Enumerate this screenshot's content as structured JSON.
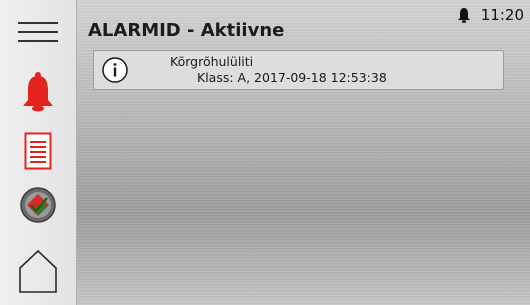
{
  "header": {
    "title": "ALARMID - Aktiivne"
  },
  "status_bar": {
    "time": "11:20",
    "notification_icon": "bell-icon"
  },
  "sidebar": {
    "items": [
      {
        "name": "menu",
        "icon": "hamburger-menu-icon"
      },
      {
        "name": "alarms",
        "icon": "bell-icon",
        "color": "#e5231d"
      },
      {
        "name": "alarm-log",
        "icon": "document-list-icon",
        "color": "#e5231d"
      },
      {
        "name": "status",
        "icon": "diamond-status-icon"
      },
      {
        "name": "home",
        "icon": "home-icon"
      }
    ]
  },
  "alarms": [
    {
      "icon": "info-icon",
      "name": "Kõrgrõhulüliti",
      "detail": "Klass: A, 2017-09-18 12:53:38"
    }
  ],
  "colors": {
    "alarm_red": "#e5231d",
    "background_metal": "#b9b9b9",
    "sidebar_bg": "#e9e9e9"
  }
}
